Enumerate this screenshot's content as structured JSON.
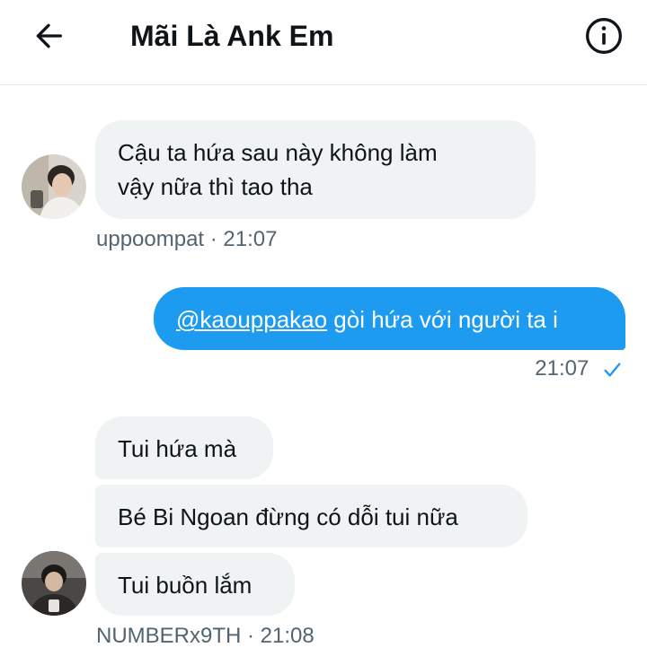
{
  "header": {
    "title": "Mãi Là Ank Em",
    "back_icon": "arrow-left-icon",
    "info_icon": "info-circle-icon"
  },
  "messages": [
    {
      "direction": "incoming",
      "lines": [
        "Cậu ta hứa sau này không làm",
        "vậy nữa thì tao tha"
      ],
      "meta": "uppoompat · 21:07"
    },
    {
      "direction": "outgoing",
      "mention": "@kaouppakao",
      "text": " gòi hứa với người ta i",
      "meta_time": "21:07",
      "status_icon": "check-icon"
    },
    {
      "direction": "incoming",
      "group": [
        "Tui hứa mà",
        "Bé Bi Ngoan đừng có dỗi tui nữa",
        "Tui buồn lắm"
      ],
      "meta": "NUMBERx9TH · 21:08"
    }
  ],
  "colors": {
    "accent": "#1d9bf0",
    "incoming_bubble": "#eff3f4",
    "meta_text": "#536471",
    "divider": "#e6ecf0"
  }
}
